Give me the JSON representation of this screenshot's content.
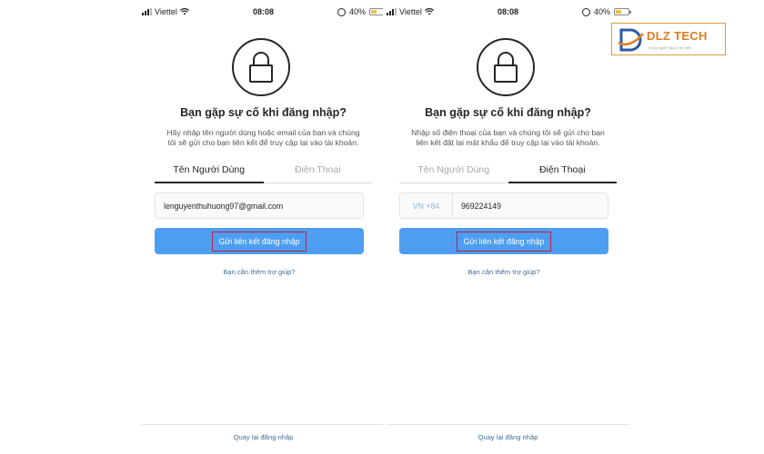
{
  "colors": {
    "primary_button": "#4d9ef0",
    "highlight_box": "#b8224a",
    "link": "#3f6e9c",
    "logo_orange": "#e07d1e",
    "logo_blue": "#2c5aa8"
  },
  "logo": {
    "text": "DLZ TECH",
    "tagline": "Công Nghệ Sáng Tạo Việt"
  },
  "left_screen": {
    "status": {
      "carrier": "Viettel",
      "time": "08:08",
      "battery": "40%"
    },
    "title": "Bạn gặp sự cố khi đăng nhập?",
    "description": "Hãy nhập tên người dùng hoặc email của bạn và chúng tôi sẽ gửi cho bạn liên kết để truy cập lại vào tài khoản.",
    "tabs": [
      "Tên Người Dùng",
      "Điện Thoại"
    ],
    "active_tab": 0,
    "input_value": "lenguyenthuhuong97@gmail.com",
    "button_label": "Gửi liên kết đăng nhập",
    "help_link": "Bạn cần thêm trợ giúp?",
    "back_link": "Quay lại đăng nhập"
  },
  "right_screen": {
    "status": {
      "carrier": "Viettel",
      "time": "08:08",
      "battery": "40%"
    },
    "title": "Bạn gặp sự cố khi đăng nhập?",
    "description": "Nhập số điện thoại của bạn và chúng tôi sẽ gửi cho bạn liên kết đặt lại mật khẩu để truy cập lại vào tài khoản.",
    "tabs": [
      "Tên Người Dùng",
      "Điện Thoại"
    ],
    "active_tab": 1,
    "country_code": "VN +84",
    "input_value": "969224149",
    "button_label": "Gửi liên kết đăng nhập",
    "help_link": "Bạn cần thêm trợ giúp?",
    "back_link": "Quay lại đăng nhập"
  }
}
